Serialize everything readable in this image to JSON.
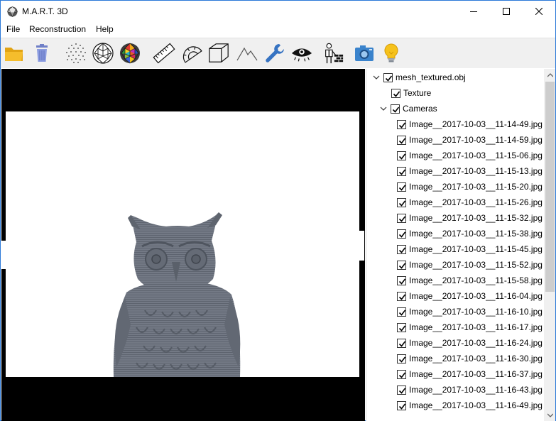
{
  "window": {
    "title": "M.A.R.T. 3D"
  },
  "menu": [
    "File",
    "Reconstruction",
    "Help"
  ],
  "toolbar": [
    "open-folder",
    "delete-trash",
    "point-cloud",
    "wireframe-mesh",
    "textured-mesh",
    "ruler",
    "protractor",
    "cube",
    "terrain",
    "wrench",
    "eye",
    "worker-settings",
    "camera",
    "lightbulb"
  ],
  "tree": {
    "root": "mesh_textured.obj",
    "texture": "Texture",
    "cameras": "Cameras",
    "images": [
      "Image__2017-10-03__11-14-49.jpg",
      "Image__2017-10-03__11-14-59.jpg",
      "Image__2017-10-03__11-15-06.jpg",
      "Image__2017-10-03__11-15-13.jpg",
      "Image__2017-10-03__11-15-20.jpg",
      "Image__2017-10-03__11-15-26.jpg",
      "Image__2017-10-03__11-15-32.jpg",
      "Image__2017-10-03__11-15-38.jpg",
      "Image__2017-10-03__11-15-45.jpg",
      "Image__2017-10-03__11-15-52.jpg",
      "Image__2017-10-03__11-15-58.jpg",
      "Image__2017-10-03__11-16-04.jpg",
      "Image__2017-10-03__11-16-10.jpg",
      "Image__2017-10-03__11-16-17.jpg",
      "Image__2017-10-03__11-16-24.jpg",
      "Image__2017-10-03__11-16-30.jpg",
      "Image__2017-10-03__11-16-37.jpg",
      "Image__2017-10-03__11-16-43.jpg",
      "Image__2017-10-03__11-16-49.jpg"
    ]
  },
  "colors": {
    "accent": "#2b79d8",
    "viewport": "#000000",
    "owl": "#6f7480"
  }
}
